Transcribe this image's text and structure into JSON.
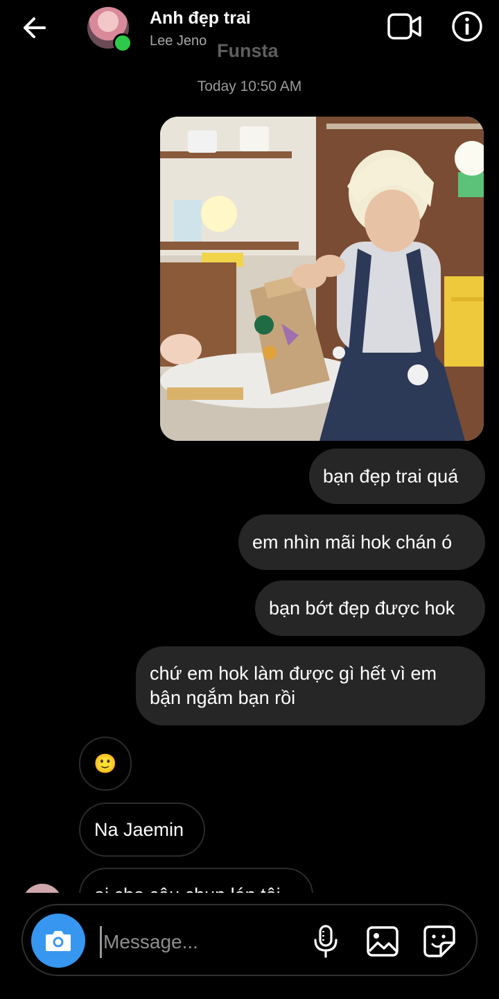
{
  "header": {
    "title": "Anh đẹp trai",
    "subtitle": "Lee Jeno",
    "watermark": "Funsta"
  },
  "timestamp": "Today 10:50 AM",
  "sent_messages": [
    "bạn đẹp trai quá",
    "em nhìn mãi hok chán ó",
    "bạn bớt đẹp được hok",
    "chứ em hok làm được gì hết vì em bận ngắm bạn rồi"
  ],
  "received_messages": {
    "emoji": "🙂",
    "name": "Na Jaemin",
    "partial": "ai cho cậu chụp lén tôi"
  },
  "composer": {
    "placeholder": "Message..."
  },
  "icons": {
    "back": "arrow-left-icon",
    "video": "video-call-icon",
    "info": "info-icon",
    "camera": "camera-icon",
    "mic": "microphone-icon",
    "gallery": "image-gallery-icon",
    "sticker": "sticker-icon"
  },
  "colors": {
    "background": "#000000",
    "bubble": "#262626",
    "camera_button": "#3797f0",
    "online": "#2ec94a"
  }
}
